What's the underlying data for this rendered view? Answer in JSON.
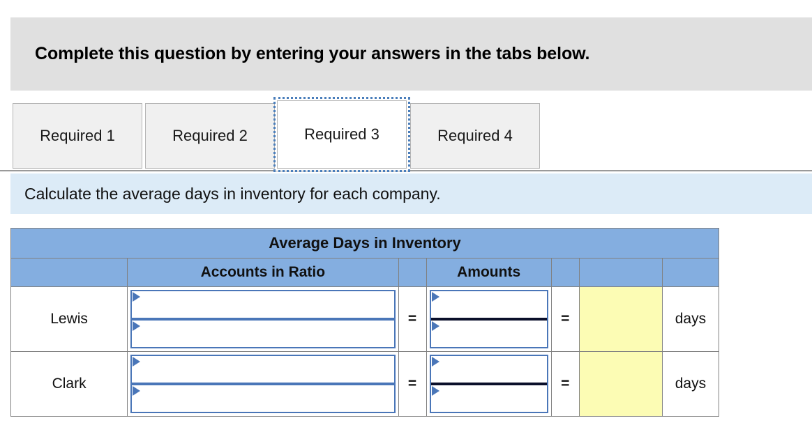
{
  "banner": {
    "text": "Complete this question by entering your answers in the tabs below."
  },
  "tabs": [
    {
      "label": "Required 1",
      "active": false
    },
    {
      "label": "Required 2",
      "active": false
    },
    {
      "label": "Required 3",
      "active": true
    },
    {
      "label": "Required 4",
      "active": false
    }
  ],
  "instruction": {
    "text": "Calculate the average days in inventory for each company."
  },
  "table": {
    "title": "Average Days in Inventory",
    "headers": {
      "blank_label": "",
      "accounts_in_ratio": "Accounts in Ratio",
      "blank_eq1": "",
      "amounts": "Amounts",
      "blank_eq2": "",
      "blank_result": "",
      "blank_units": ""
    },
    "equals_sign": "=",
    "units_label": "days",
    "rows": [
      {
        "company": "Lewis",
        "accounts_numerator": "",
        "accounts_denominator": "",
        "amounts_numerator": "",
        "amounts_denominator": "",
        "result": "",
        "units": "days"
      },
      {
        "company": "Clark",
        "accounts_numerator": "",
        "accounts_denominator": "",
        "amounts_numerator": "",
        "amounts_denominator": "",
        "result": "",
        "units": "days"
      }
    ]
  },
  "colors": {
    "banner_bg": "#e0e0e0",
    "instruction_bg": "#dcebf7",
    "header_blue": "#84aee0",
    "input_border": "#4a76b8",
    "result_yellow": "#fcfcb4",
    "tab_bg": "#f0f0f0",
    "tab_active_bg": "#ffffff",
    "focus_outline": "#4a7ebb",
    "grid_border": "#808080"
  }
}
